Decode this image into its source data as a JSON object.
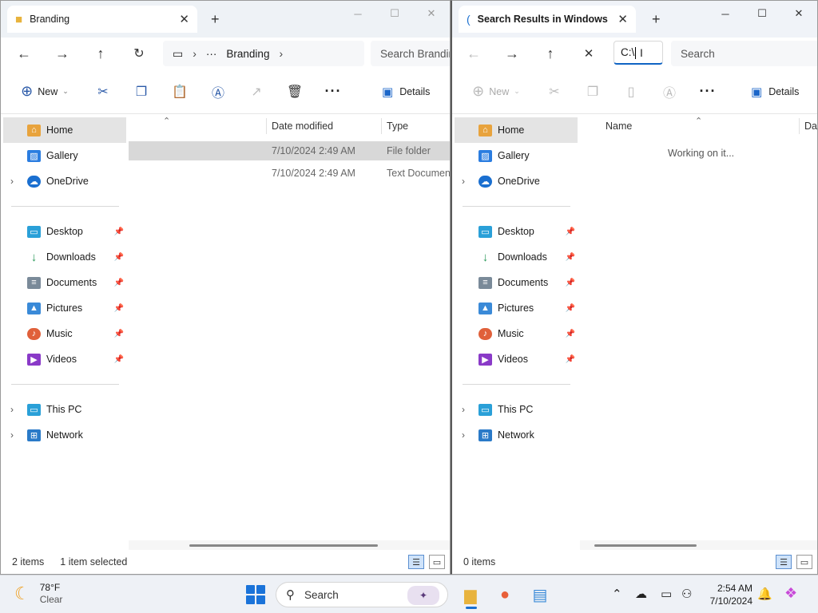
{
  "left_window": {
    "tab_title": "Branding",
    "breadcrumb": {
      "overflow": "···",
      "current": "Branding"
    },
    "search_placeholder": "Search Branding",
    "toolbar": {
      "new_label": "New",
      "details_label": "Details"
    },
    "columns": {
      "date_modified": "Date modified",
      "type": "Type"
    },
    "rows": [
      {
        "date": "7/10/2024 2:49 AM",
        "type": "File folder",
        "selected": true
      },
      {
        "date": "7/10/2024 2:49 AM",
        "type": "Text Document",
        "selected": false
      }
    ],
    "status": {
      "count": "2 items",
      "selection": "1 item selected"
    }
  },
  "right_window": {
    "tab_title": "Search Results in Windows",
    "address_value": "C:\\",
    "search_placeholder": "Search",
    "toolbar": {
      "new_label": "New",
      "details_label": "Details"
    },
    "columns": {
      "name": "Name",
      "date": "Date"
    },
    "working_text": "Working on it...",
    "status": {
      "count": "0 items"
    }
  },
  "nav_pane": {
    "top": [
      {
        "name": "home",
        "label": "Home",
        "icon": "home-icon",
        "color": "#e8a33d"
      },
      {
        "name": "gallery",
        "label": "Gallery",
        "icon": "gallery-icon",
        "color": "#2b7de0"
      },
      {
        "name": "onedrive",
        "label": "OneDrive",
        "icon": "cloud-icon",
        "color": "#1a6fd0"
      }
    ],
    "quick_access": [
      {
        "name": "desktop",
        "label": "Desktop",
        "icon": "desktop-icon",
        "color": "#2aa0d8"
      },
      {
        "name": "downloads",
        "label": "Downloads",
        "icon": "download-icon",
        "color": "#2a9a5a"
      },
      {
        "name": "documents",
        "label": "Documents",
        "icon": "document-icon",
        "color": "#7a8a99"
      },
      {
        "name": "pictures",
        "label": "Pictures",
        "icon": "picture-icon",
        "color": "#3a8ad8"
      },
      {
        "name": "music",
        "label": "Music",
        "icon": "music-icon",
        "color": "#e0603a"
      },
      {
        "name": "videos",
        "label": "Videos",
        "icon": "video-icon",
        "color": "#8a3ac8"
      }
    ],
    "bottom": [
      {
        "name": "this-pc",
        "label": "This PC",
        "icon": "computer-icon",
        "color": "#2aa0d8"
      },
      {
        "name": "network",
        "label": "Network",
        "icon": "network-icon",
        "color": "#2a7ac8"
      }
    ]
  },
  "taskbar": {
    "weather_temp": "78°F",
    "weather_cond": "Clear",
    "search_label": "Search",
    "time": "2:54 AM",
    "date": "7/10/2024"
  }
}
